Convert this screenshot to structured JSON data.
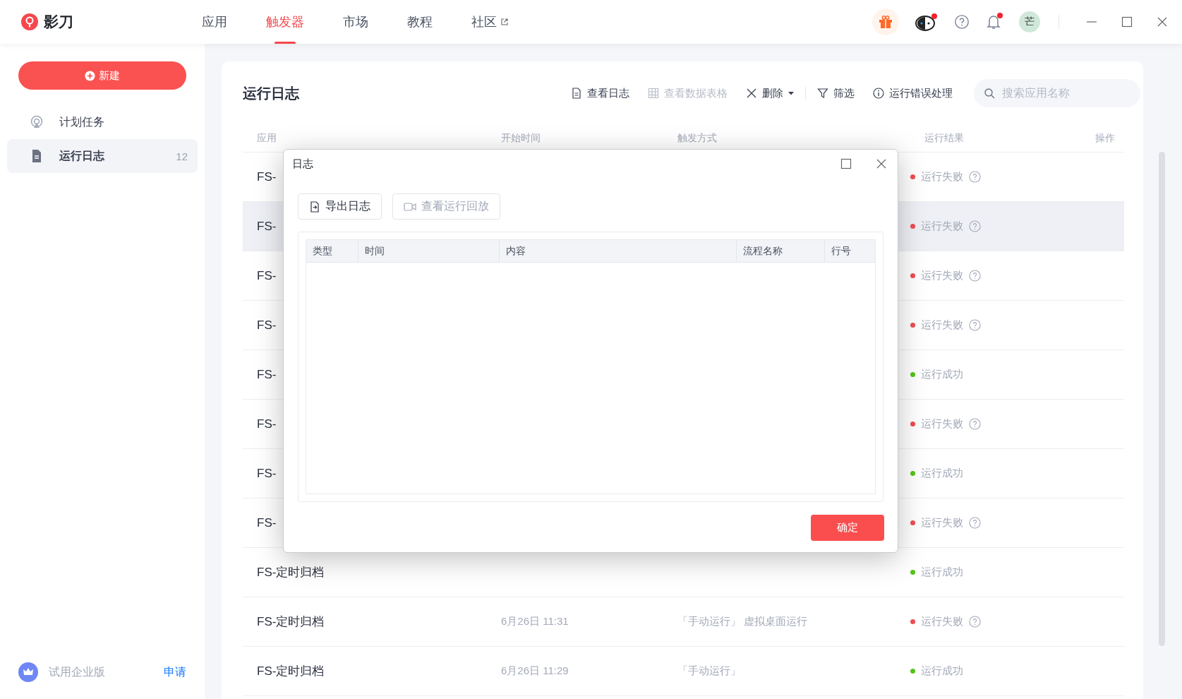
{
  "app": {
    "name": "影刀"
  },
  "nav": [
    {
      "label": "应用",
      "selected": false,
      "external": false
    },
    {
      "label": "触发器",
      "selected": true,
      "external": false
    },
    {
      "label": "市场",
      "selected": false,
      "external": false
    },
    {
      "label": "教程",
      "selected": false,
      "external": false
    },
    {
      "label": "社区",
      "selected": false,
      "external": true
    }
  ],
  "user": {
    "avatar": "芒"
  },
  "sidebar": {
    "new_button": "新建",
    "items": [
      {
        "label": "计划任务",
        "selected": false
      },
      {
        "label": "运行日志",
        "selected": true,
        "count": "12"
      }
    ],
    "footer": {
      "label": "试用企业版",
      "link": "申请"
    }
  },
  "page": {
    "title": "运行日志",
    "toolbar": [
      {
        "label": "查看日志",
        "disabled": false,
        "dropdown": false
      },
      {
        "label": "查看数据表格",
        "disabled": true,
        "dropdown": false
      },
      {
        "label": "删除",
        "disabled": false,
        "dropdown": true
      },
      {
        "label": "筛选",
        "disabled": false,
        "dropdown": false
      },
      {
        "label": "运行错误处理",
        "disabled": false,
        "dropdown": false
      }
    ],
    "search": {
      "placeholder": "搜索应用名称"
    }
  },
  "table": {
    "columns": [
      "应用",
      "开始时间",
      "触发方式",
      "运行结果",
      "操作"
    ],
    "rows": [
      {
        "app": "FS-",
        "result": "运行失败",
        "kind": "failed",
        "selected": false
      },
      {
        "app": "FS-",
        "result": "运行失败",
        "kind": "failed",
        "selected": true
      },
      {
        "app": "FS-",
        "result": "运行失败",
        "kind": "failed",
        "selected": false
      },
      {
        "app": "FS-",
        "result": "运行失败",
        "kind": "failed",
        "selected": false
      },
      {
        "app": "FS-",
        "result": "运行成功",
        "kind": "success",
        "selected": false
      },
      {
        "app": "FS-",
        "result": "运行失败",
        "kind": "failed",
        "selected": false
      },
      {
        "app": "FS-",
        "result": "运行成功",
        "kind": "success",
        "selected": false
      },
      {
        "app": "FS-",
        "result": "运行失败",
        "kind": "failed",
        "selected": false
      },
      {
        "app": "FS-定时归档",
        "result": "运行成功",
        "kind": "success",
        "selected": false
      },
      {
        "app": "FS-定时归档",
        "start_time": "6月26日 11:31",
        "trigger": "「手动运行」 虚拟桌面运行",
        "result": "运行失败",
        "kind": "failed",
        "selected": false
      },
      {
        "app": "FS-定时归档",
        "start_time": "6月26日 11:29",
        "trigger": "「手动运行」",
        "result": "运行成功",
        "kind": "success",
        "selected": false
      }
    ]
  },
  "dialog": {
    "title": "日志",
    "buttons": [
      {
        "label": "导出日志",
        "disabled": false
      },
      {
        "label": "查看运行回放",
        "disabled": true
      }
    ],
    "columns": [
      "类型",
      "时间",
      "内容",
      "流程名称",
      "行号"
    ],
    "ok": "确定"
  }
}
